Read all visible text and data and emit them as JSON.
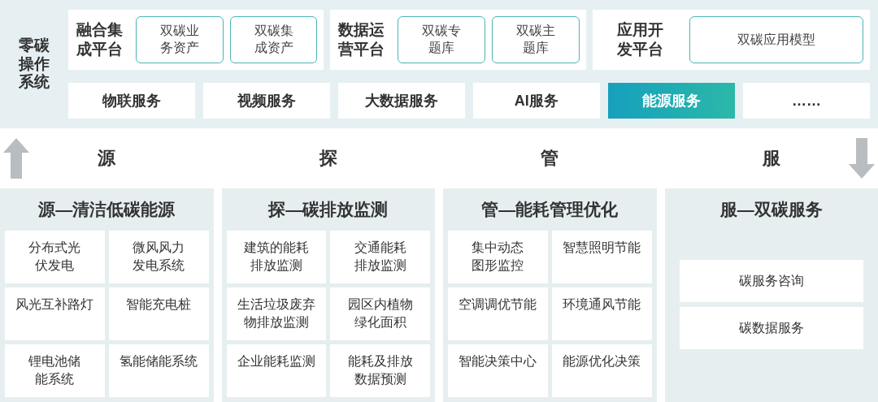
{
  "system_label": "零碳操作系统",
  "platforms": [
    {
      "label": "融合集成平台",
      "items": [
        "双碳业务资产",
        "双碳集成资产"
      ]
    },
    {
      "label": "数据运营平台",
      "items": [
        "双碳专题库",
        "双碳主题库"
      ]
    },
    {
      "label": "应用开发平台",
      "items": [
        "双碳应用模型"
      ]
    }
  ],
  "services": [
    {
      "label": "物联服务",
      "selected": false
    },
    {
      "label": "视频服务",
      "selected": false
    },
    {
      "label": "大数据服务",
      "selected": false
    },
    {
      "label": "AI服务",
      "selected": false
    },
    {
      "label": "能源服务",
      "selected": true
    },
    {
      "label": "……",
      "selected": false
    }
  ],
  "stages": [
    "源",
    "探",
    "管",
    "服"
  ],
  "columns": [
    {
      "kind": "grid",
      "title": "源—清洁低碳能源",
      "items": [
        "分布式光伏发电",
        "微风风力发电系统",
        "风光互补路灯",
        "智能充电桩",
        "锂电池储能系统",
        "氢能储能系统"
      ]
    },
    {
      "kind": "grid",
      "title": "探—碳排放监测",
      "items": [
        "建筑的能耗排放监测",
        "交通能耗排放监测",
        "生活垃圾废弃物排放监测",
        "园区内植物绿化面积",
        "企业能耗监测",
        "能耗及排放数据预测"
      ]
    },
    {
      "kind": "grid",
      "title": "管—能耗管理优化",
      "items": [
        "集中动态图形监控",
        "智慧照明节能",
        "空调调优节能",
        "环境通风节能",
        "智能决策中心",
        "能源优化决策"
      ]
    },
    {
      "kind": "list",
      "title": "服—双碳服务",
      "items": [
        "碳服务咨询",
        "碳数据服务"
      ]
    }
  ]
}
